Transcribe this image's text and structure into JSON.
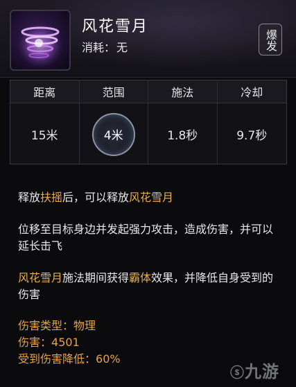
{
  "skill": {
    "name": "风花雪月",
    "cost_label": "消耗：",
    "cost_value": "无",
    "badge": "爆发"
  },
  "stats": {
    "headers": [
      "距离",
      "范围",
      "施法",
      "冷却"
    ],
    "values": [
      "15米",
      "4米",
      "1.8秒",
      "9.7秒"
    ]
  },
  "description": {
    "line1_prefix": "释放",
    "line1_key1": "扶摇",
    "line1_mid": "后，可以释放",
    "line1_key2": "风花雪月",
    "line2": "位移至目标身边并发起强力攻击，造成伤害，并可以延长击飞",
    "line3_key1": "风花雪月",
    "line3_mid": "施法期间获得",
    "line3_key2": "霸体",
    "line3_suffix": "效果，并降低自身受到的伤害"
  },
  "damage": {
    "type_label": "伤害类型：",
    "type_value": "物理",
    "dmg_label": "伤害：",
    "dmg_value": "4501",
    "reduce_label": "受到伤害降低：",
    "reduce_value": "60%"
  },
  "watermark": "九游",
  "colors": {
    "accent": "#e8b04f",
    "cooldown": "#e3a34a"
  }
}
